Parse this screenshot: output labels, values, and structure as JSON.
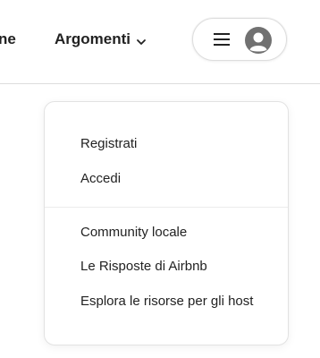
{
  "header": {
    "nav_cut_label": "ne",
    "topics_label": "Argomenti",
    "topics_icon": "chevron-down-icon",
    "menu_icon": "hamburger-icon",
    "avatar_icon": "user-avatar-icon"
  },
  "menu": {
    "items_top": [
      {
        "label": "Registrati"
      },
      {
        "label": "Accedi"
      }
    ],
    "items_bottom": [
      {
        "label": "Community locale"
      },
      {
        "label": "Le Risposte di Airbnb"
      },
      {
        "label": "Esplora le risorse per gli host"
      }
    ]
  },
  "colors": {
    "text": "#222222",
    "border": "#dddddd",
    "avatar": "#717171"
  }
}
